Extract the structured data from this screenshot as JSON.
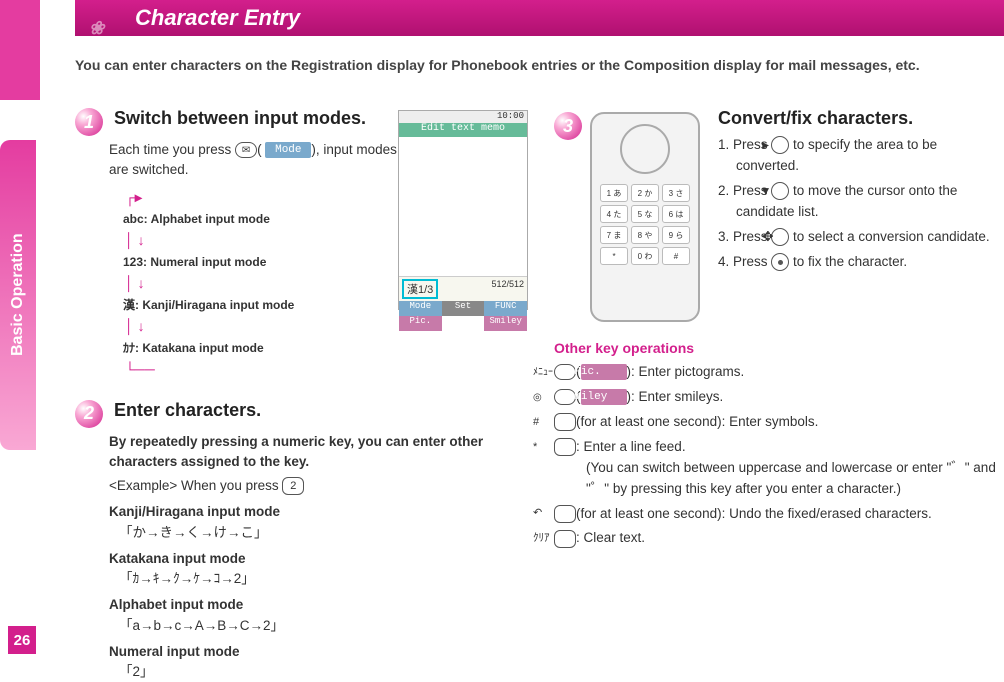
{
  "sidebar": {
    "label": "Basic Operation",
    "page": "26"
  },
  "title": "Character Entry",
  "intro": "You can enter characters on the Registration display for Phonebook entries or the Composition display for mail messages, etc.",
  "step1": {
    "num": "1",
    "head": "Switch between input modes.",
    "line1a": "Each time you press ",
    "mode_soft": "Mode",
    "line1b": ", input modes are switched.",
    "modes": {
      "abc": "abc: Alphabet input mode",
      "num": "123: Numeral input mode",
      "kanji": "漢: Kanji/Hiragana input mode",
      "kana": "ｶﾅ: Katakana input mode"
    }
  },
  "screenshot": {
    "clock": "10:00",
    "header": "Edit text memo",
    "modebadge": "漢1/3",
    "counter": "512/512",
    "soft_left": "Mode",
    "soft_mid_top": "Set",
    "soft_right": "FUNC",
    "soft_left2": "Pic.",
    "soft_right2": "Smiley"
  },
  "step2": {
    "num": "2",
    "head": "Enter characters.",
    "sub": "By repeatedly pressing a numeric key, you can enter other characters assigned to the key.",
    "example_label": "<Example> When you press ",
    "example_key": "2",
    "kanji_name": "Kanji/Hiragana input mode",
    "kanji_seq": "「か→き→く→け→こ」",
    "kata_name": "Katakana input mode",
    "kata_seq": "「ｶ→ｷ→ｸ→ｹ→ｺ→2」",
    "alpha_name": "Alphabet input mode",
    "alpha_seq": "「a→b→c→A→B→C→2」",
    "numr_name": "Numeral input mode",
    "numr_seq": "「2」"
  },
  "step3": {
    "num": "3",
    "head": "Convert/fix characters.",
    "i1": "1. Press ",
    "i1b": " to specify the area to be converted.",
    "i2": "2. Press ",
    "i2b": " to move the cursor onto the candidate list.",
    "i3": "3. Press ",
    "i3b": " to select a conversion candidate.",
    "i4": "4. Press ",
    "i4b": " to fix the character."
  },
  "other": {
    "head": "Other key operations",
    "menu_key": "ﾒﾆｭｰ",
    "pic_soft": "Pic.",
    "pic_text": ": Enter pictograms.",
    "cam_key": "◎",
    "smiley_soft": "Smiley",
    "smiley_text": ": Enter smileys.",
    "hash_key": "#",
    "hash_text": "(for at least one second): Enter symbols.",
    "star_key": "*",
    "star_text1": ": Enter a line feed.",
    "star_text2": "(You can switch between uppercase and lowercase or enter \"゛\" and \"゜\" by pressing this key after you enter a character.)",
    "call_key": "↶",
    "call_text": "(for at least one second): Undo the fixed/erased characters.",
    "clr_key": "ｸﾘｱ",
    "clr_text": ": Clear text."
  }
}
